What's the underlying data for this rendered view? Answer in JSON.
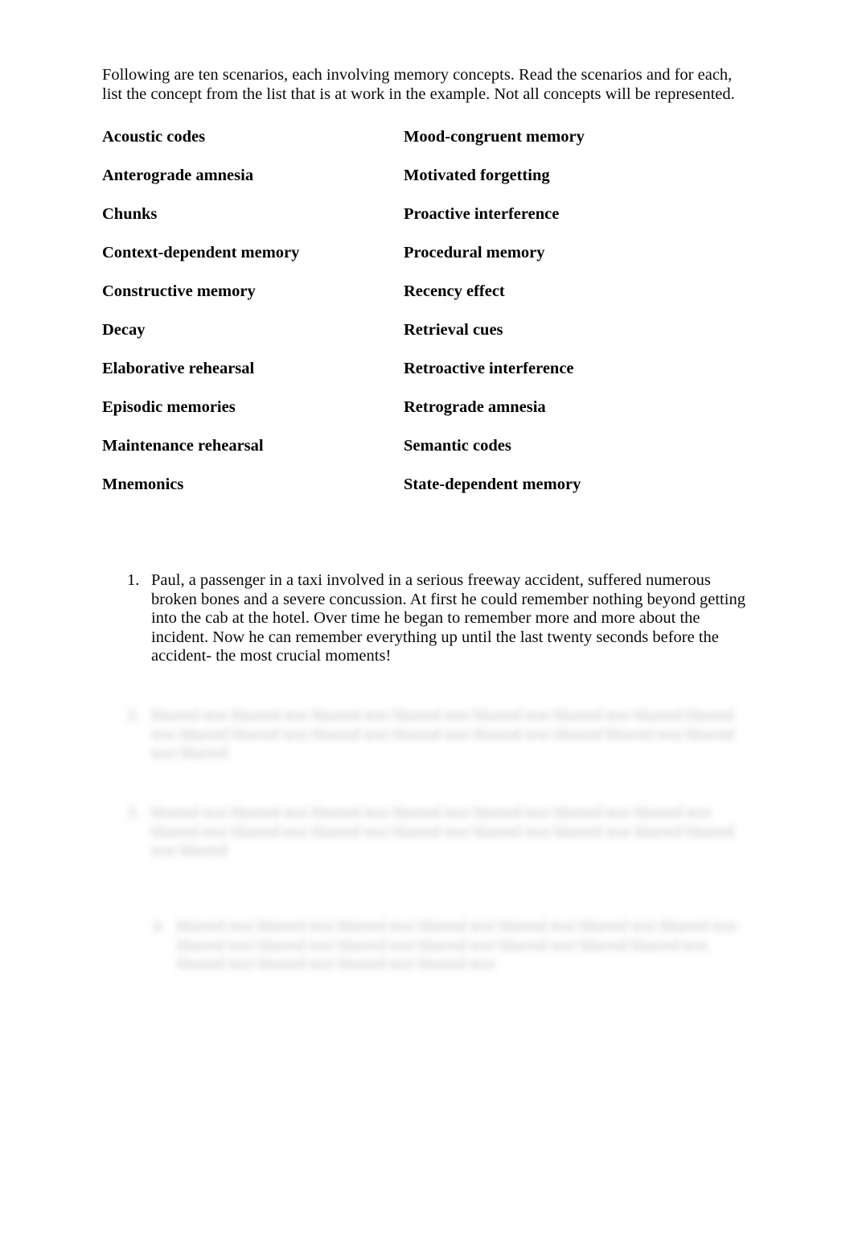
{
  "document": {
    "intro": "Following are ten scenarios, each involving memory concepts. Read the scenarios and for each, list the concept from the list that is at work in the example. Not all concepts will be represented."
  },
  "concept_list": {
    "left_column": [
      {
        "label": "Acoustic codes"
      },
      {
        "label": "Anterograde amnesia"
      },
      {
        "label": "Chunks"
      },
      {
        "label": "Context-dependent memory"
      },
      {
        "label": "Constructive memory"
      },
      {
        "label": "Decay"
      },
      {
        "label": "Elaborative rehearsal"
      },
      {
        "label": "Episodic memories"
      },
      {
        "label": "Maintenance rehearsal"
      },
      {
        "label": "Mnemonics"
      }
    ],
    "right_column": [
      {
        "label": "Mood-congruent memory"
      },
      {
        "label": "Motivated forgetting"
      },
      {
        "label": "Proactive interference"
      },
      {
        "label": "Procedural memory"
      },
      {
        "label": "Recency effect"
      },
      {
        "label": "Retrieval cues"
      },
      {
        "label": "Retroactive interference"
      },
      {
        "label": "Retrograde amnesia"
      },
      {
        "label": "Semantic codes"
      },
      {
        "label": "State-dependent memory"
      }
    ]
  },
  "scenarios": [
    {
      "number": "1.",
      "text": "Paul, a passenger in a taxi involved in a serious freeway accident, suffered numerous broken bones and a severe concussion. At first he could remember nothing beyond getting into the cab at the hotel. Over time he began to remember more and more about the incident. Now he can remember everything up until the last twenty seconds before the accident- the most crucial moments!",
      "legible": true
    },
    {
      "number": "2.",
      "text": "blurred text blurred text blurred text blurred text blurred text blurred text blurred blurred text blurred blurred text blurred text blurred text blurred text blurred blurred text blurred text blurred",
      "legible": false
    },
    {
      "number": "3.",
      "text": "blurred text blurred text blurred text blurred text blurred text blurred text blurred text blurred text blurred text blurred text blurred text blurred text blurred text blurred blurred text blurred",
      "legible": false
    },
    {
      "number": "4.",
      "text": "blurred text blurred text blurred text blurred text blurred text blurred text blurred text blurred text blurred text blurred text blurred text blurred text blurred blurred text blurred text blurred text blurred text blurred text",
      "legible": false
    }
  ]
}
